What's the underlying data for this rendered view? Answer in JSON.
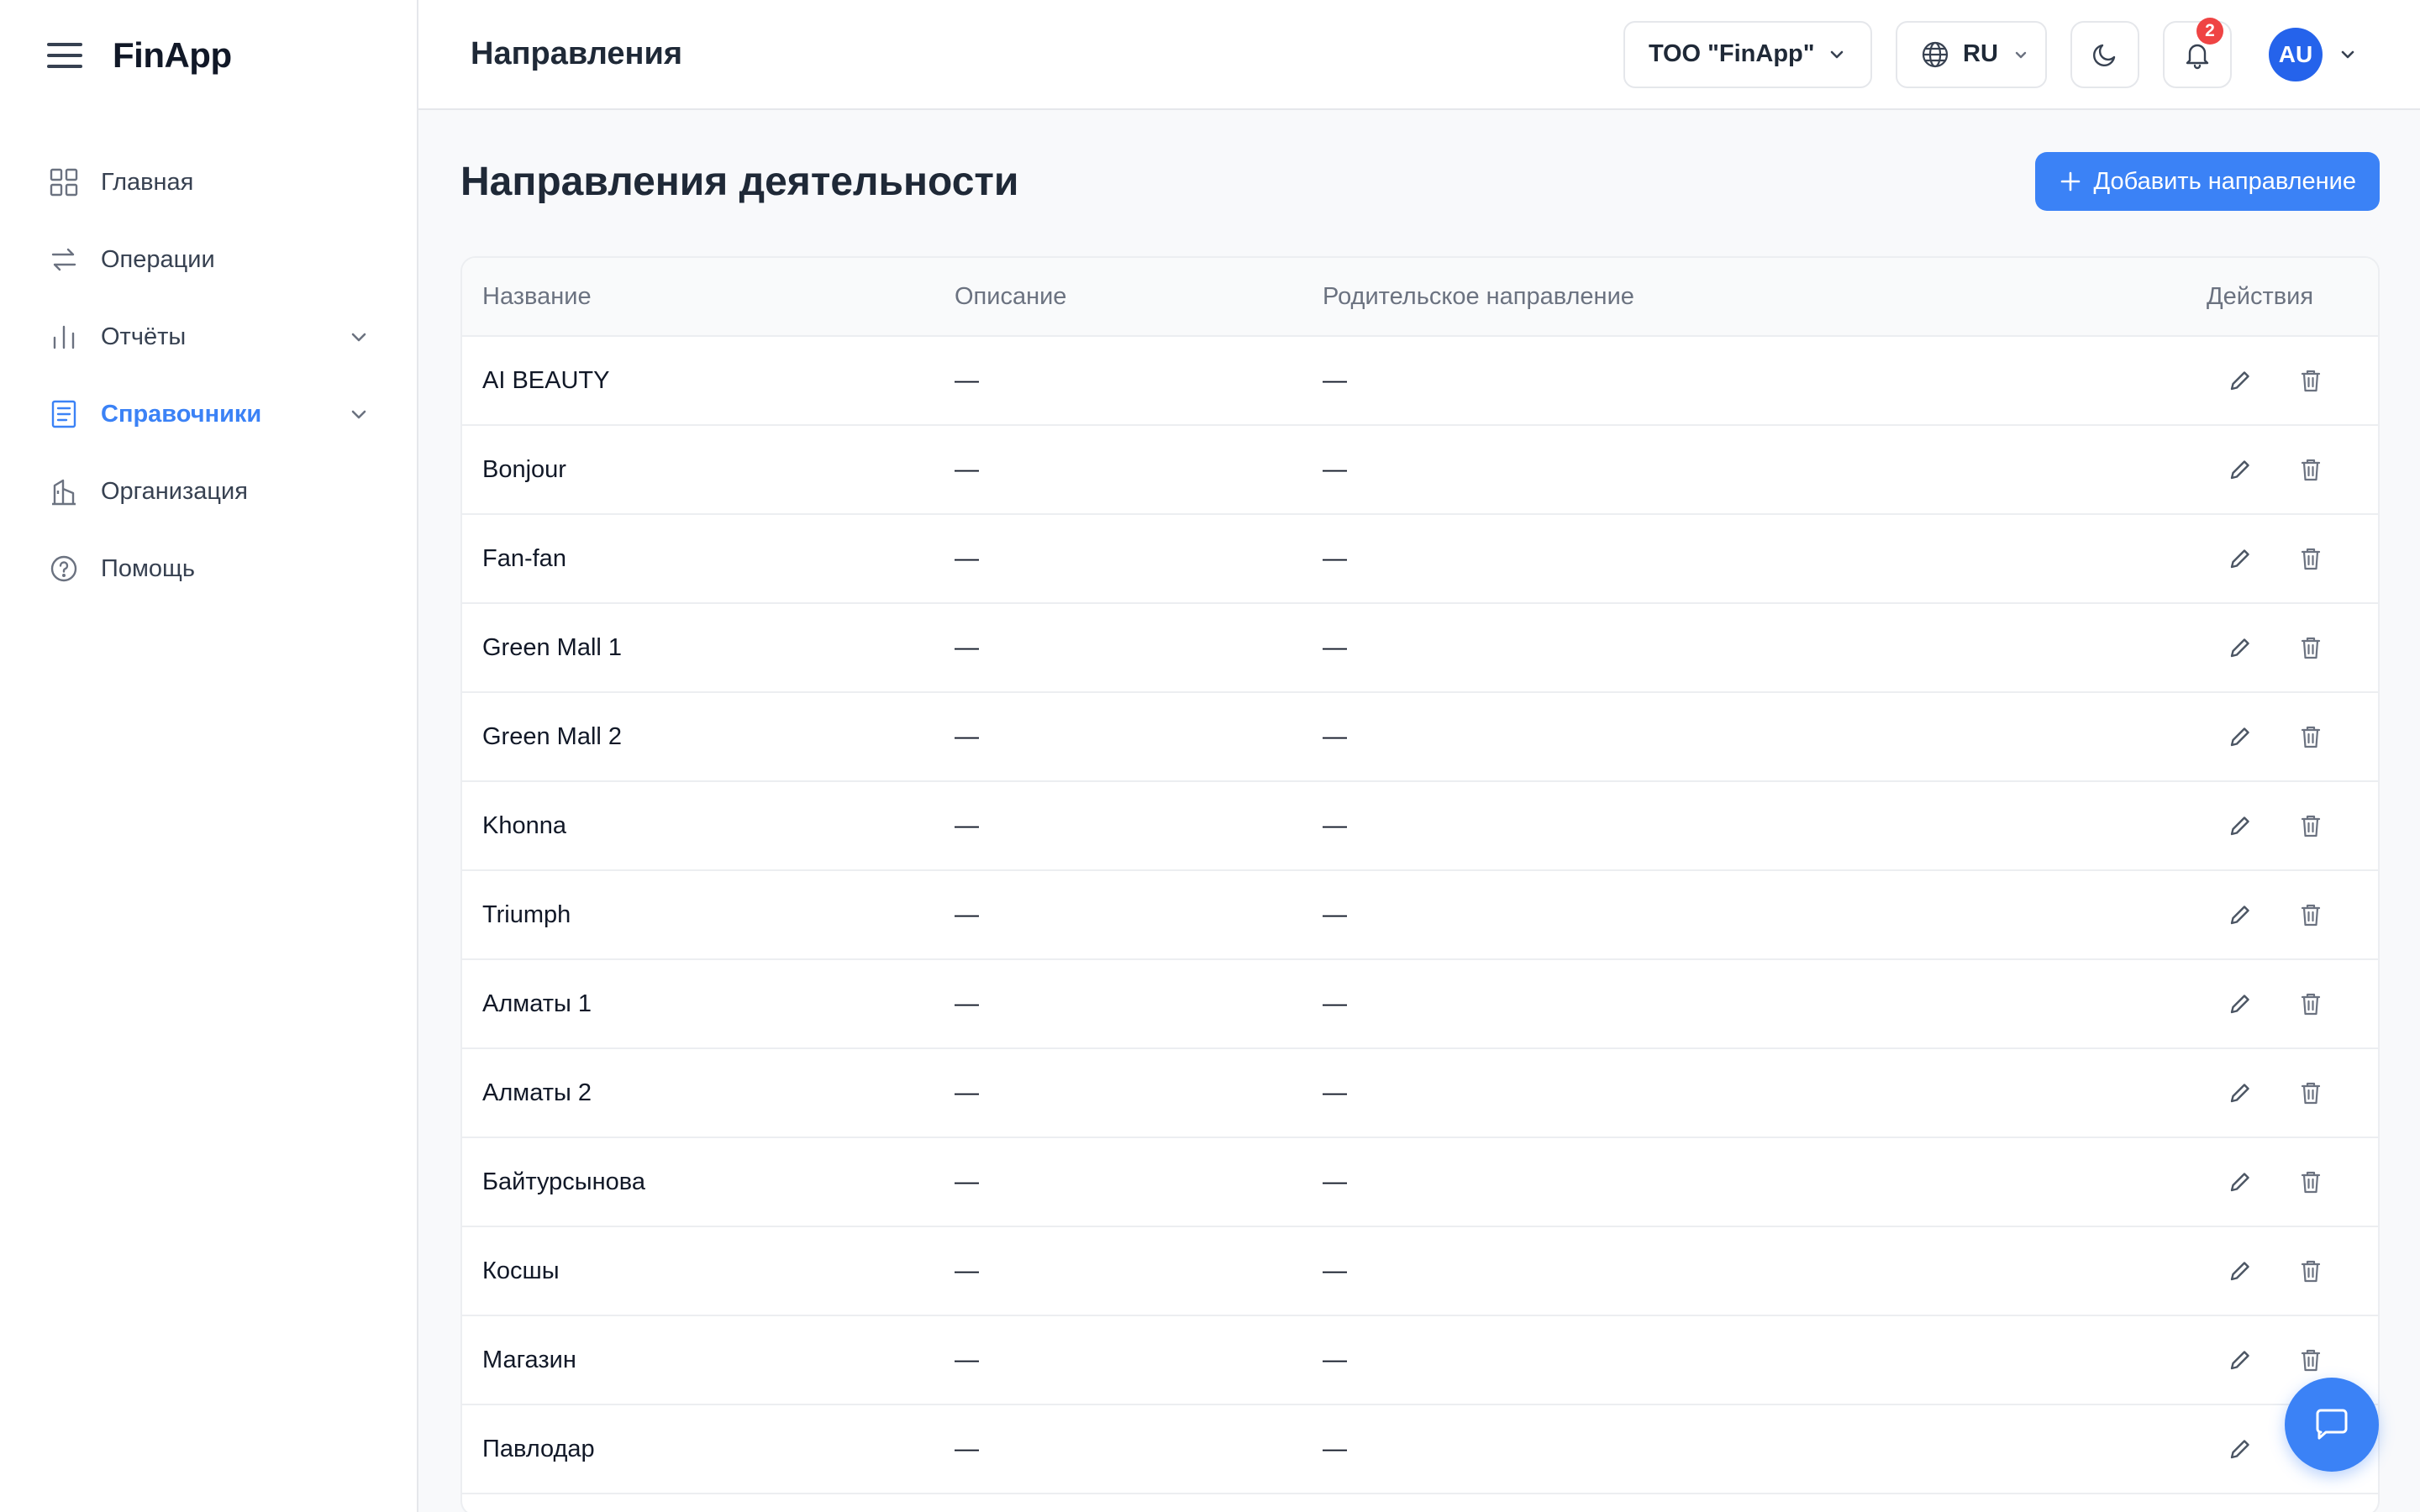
{
  "app": {
    "name": "FinApp"
  },
  "sidebar": {
    "items": [
      {
        "label": "Главная",
        "icon": "grid-icon",
        "active": false,
        "expandable": false
      },
      {
        "label": "Операции",
        "icon": "arrows-exchange-icon",
        "active": false,
        "expandable": false
      },
      {
        "label": "Отчёты",
        "icon": "bar-chart-icon",
        "active": false,
        "expandable": true
      },
      {
        "label": "Справочники",
        "icon": "book-icon",
        "active": true,
        "expandable": true
      },
      {
        "label": "Организация",
        "icon": "building-icon",
        "active": false,
        "expandable": false
      },
      {
        "label": "Помощь",
        "icon": "help-circle-icon",
        "active": false,
        "expandable": false
      }
    ]
  },
  "header": {
    "title": "Направления",
    "organization": "ТОО \"FinApp\"",
    "language": "RU",
    "notifications_count": "2",
    "avatar_initials": "AU"
  },
  "page": {
    "title": "Направления деятельности",
    "add_button_label": "Добавить направление"
  },
  "table": {
    "columns": [
      "Название",
      "Описание",
      "Родительское направление",
      "Действия"
    ],
    "rows": [
      {
        "name": "AI BEAUTY",
        "description": "—",
        "parent": "—"
      },
      {
        "name": "Bonjour",
        "description": "—",
        "parent": "—"
      },
      {
        "name": "Fan-fan",
        "description": "—",
        "parent": "—"
      },
      {
        "name": "Green Mall 1",
        "description": "—",
        "parent": "—"
      },
      {
        "name": "Green Mall 2",
        "description": "—",
        "parent": "—"
      },
      {
        "name": "Khonna",
        "description": "—",
        "parent": "—"
      },
      {
        "name": "Triumph",
        "description": "—",
        "parent": "—"
      },
      {
        "name": "Алматы 1",
        "description": "—",
        "parent": "—"
      },
      {
        "name": "Алматы 2",
        "description": "—",
        "parent": "—"
      },
      {
        "name": "Байтурсынова",
        "description": "—",
        "parent": "—"
      },
      {
        "name": "Косшы",
        "description": "—",
        "parent": "—"
      },
      {
        "name": "Магазин",
        "description": "—",
        "parent": "—"
      },
      {
        "name": "Павлодар",
        "description": "—",
        "parent": "—"
      }
    ]
  },
  "colors": {
    "accent": "#3b82f6",
    "badge": "#ef4444",
    "avatar": "#2563eb"
  }
}
